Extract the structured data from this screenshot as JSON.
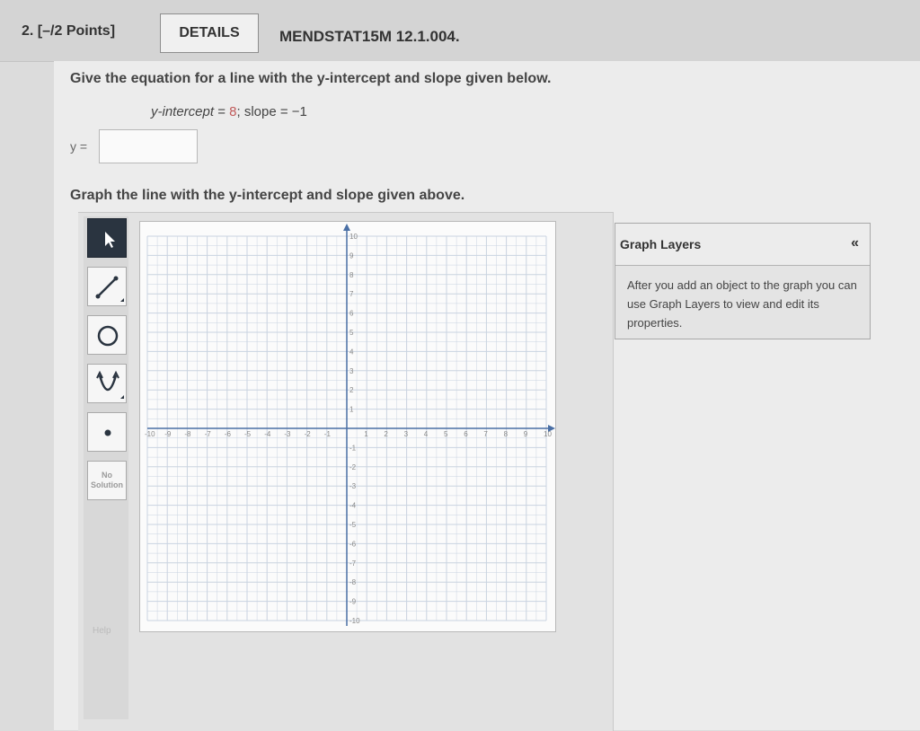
{
  "header": {
    "question_number": "2.",
    "points": "[–/2 Points]",
    "details_label": "DETAILS",
    "problem_code": "MENDSTAT15M 12.1.004."
  },
  "question": {
    "prompt": "Give the equation for a line with the y-intercept and slope given below.",
    "given_intercept_label": "y-intercept",
    "given_intercept_value": "8",
    "given_slope_label": "slope",
    "given_slope_value": "−1",
    "answer_label": "y =",
    "answer_value": "",
    "graph_prompt": "Graph the line with the y-intercept and slope given above."
  },
  "toolbar": {
    "tools": [
      "select-pointer",
      "line-tool",
      "circle-tool",
      "parabola-tool",
      "point-tool"
    ],
    "no_solution_line1": "No",
    "no_solution_line2": "Solution",
    "help": "Help"
  },
  "graph": {
    "x_range": [
      -10,
      10
    ],
    "y_range": [
      -10,
      10
    ],
    "x_tick_labels": [
      "-10",
      "-9",
      "-8",
      "-7",
      "-6",
      "-5",
      "-4",
      "-3",
      "-2",
      "-1",
      "1",
      "2",
      "3",
      "4",
      "5",
      "6",
      "7",
      "8",
      "9",
      "10"
    ],
    "y_tick_labels": [
      "10",
      "9",
      "8",
      "7",
      "6",
      "5",
      "4",
      "3",
      "2",
      "1",
      "-1",
      "-2",
      "-3",
      "-4",
      "-5",
      "-6",
      "-7",
      "-8",
      "-9",
      "-10"
    ],
    "axis_color": "#4a6fa5",
    "grid_color": "#c9d3e0"
  },
  "layers": {
    "title": "Graph Layers",
    "collapse": "«",
    "message": "After you add an object to the graph you can use Graph Layers to view and edit its properties."
  }
}
